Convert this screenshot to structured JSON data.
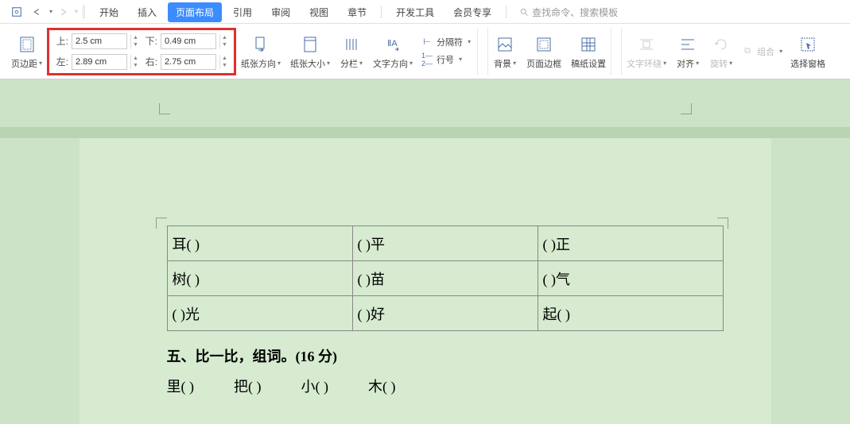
{
  "tabs": {
    "start": "开始",
    "insert": "插入",
    "page_layout": "页面布局",
    "reference": "引用",
    "review": "审阅",
    "view": "视图",
    "chapter": "章节",
    "dev_tools": "开发工具",
    "member": "会员专享"
  },
  "search": {
    "placeholder": "查找命令、搜索模板"
  },
  "margins": {
    "top_label": "上:",
    "top_value": "2.5 cm",
    "bottom_label": "下:",
    "bottom_value": "0.49 cm",
    "left_label": "左:",
    "left_value": "2.89 cm",
    "right_label": "右:",
    "right_value": "2.75 cm"
  },
  "ribbon": {
    "page_margin": "页边距",
    "paper_orient": "纸张方向",
    "paper_size": "纸张大小",
    "columns": "分栏",
    "text_direction": "文字方向",
    "breaks": "分隔符",
    "line_number": "行号",
    "background": "背景",
    "page_border": "页面边框",
    "writing_paper": "稿纸设置",
    "text_wrap": "文字环绕",
    "align": "对齐",
    "rotate": "旋转",
    "group": "组合",
    "select_pane": "选择窗格"
  },
  "document": {
    "table": [
      [
        "耳(       )",
        "(       )平",
        "(       )正"
      ],
      [
        "树(       )",
        "(       )苗",
        "(       )气"
      ],
      [
        "(       )光",
        "(       )好",
        "起(       )"
      ]
    ],
    "heading": "五、比一比，组词。(16   分)",
    "line": [
      "里(              )",
      "把(              )",
      "小(              )",
      "木(              )"
    ]
  }
}
